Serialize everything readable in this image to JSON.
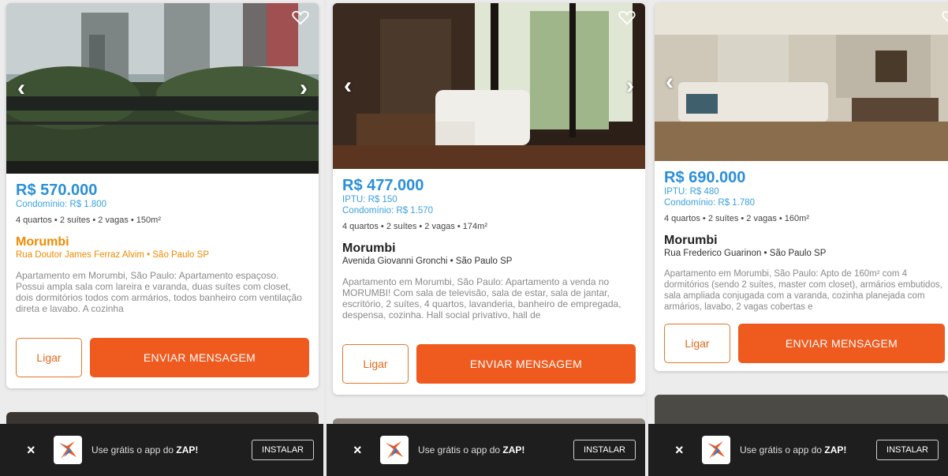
{
  "listings": [
    {
      "price": "R$ 570.000",
      "iptu": "",
      "condo": "Condomínio: R$ 1.800",
      "features": "4 quartos • 2 suítes • 2 vagas • 150m²",
      "neighborhood": "Morumbi",
      "address": "Rua Doutor James Ferraz Alvim • São Paulo SP",
      "description": "Apartamento em Morumbi, São Paulo: Apartamento espaçoso. Possui ampla sala com lareira e varanda, duas suítes com closet, dois dormitórios todos com armários, todos banheiro com ventilação direta e lavabo. A cozinha",
      "call_label": "Ligar",
      "message_label": "ENVIAR MENSAGEM"
    },
    {
      "price": "R$ 477.000",
      "iptu": "IPTU: R$ 150",
      "condo": "Condomínio: R$ 1.570",
      "features": "4 quartos • 2 suítes • 2 vagas • 174m²",
      "neighborhood": "Morumbi",
      "address": "Avenida Giovanni Gronchi • São Paulo SP",
      "description": "Apartamento em Morumbi, São Paulo: Apartamento a venda no MORUMBI! Com sala de televisão, sala de estar, sala de jantar, escritório, 2 suítes, 4 quartos, lavanderia, banheiro de empregada, despensa, cozinha. Hall social privativo, hall de",
      "call_label": "Ligar",
      "message_label": "ENVIAR MENSAGEM"
    },
    {
      "price": "R$ 690.000",
      "iptu": "IPTU: R$ 480",
      "condo": "Condomínio: R$ 1.780",
      "features": "4 quartos • 2 suítes • 2 vagas • 160m²",
      "neighborhood": "Morumbi",
      "address": "Rua Frederico Guarinon • São Paulo SP",
      "description": "Apartamento em Morumbi, São Paulo: Apto de 160m² com 4 dormitórios (sendo 2 suítes, master com closet), armários embutidos, sala ampliada conjugada com a varanda, cozinha planejada com armários, lavabo, 2 vagas cobertas e",
      "call_label": "Ligar",
      "message_label": "ENVIAR MENSAGEM"
    }
  ],
  "banner": {
    "close": "×",
    "text": "Use grátis o app do ",
    "brand": "ZAP!",
    "install_label": "INSTALAR"
  },
  "icons": {
    "prev": "‹",
    "next": "›"
  },
  "colors": {
    "price": "#2b8fd8",
    "accent": "#ef5a1e",
    "highlight": "#f08a00"
  }
}
